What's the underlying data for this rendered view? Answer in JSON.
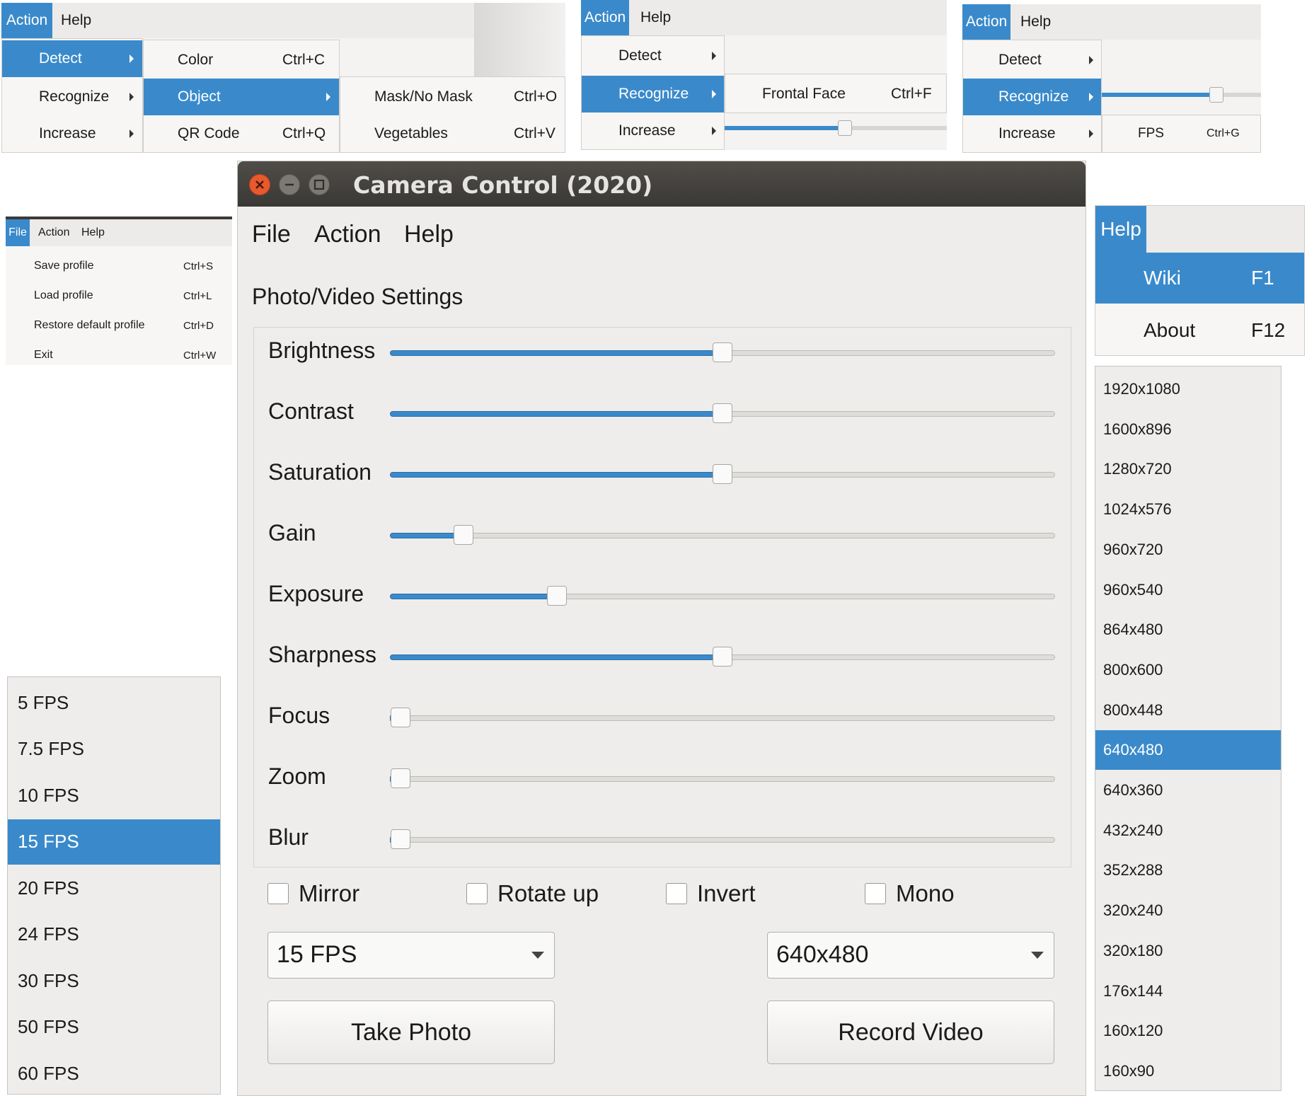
{
  "snippet1": {
    "menubar": [
      "Action",
      "Help"
    ],
    "menu": [
      {
        "label": "Detect"
      },
      {
        "label": "Recognize"
      },
      {
        "label": "Increase"
      }
    ],
    "detect_submenu": [
      {
        "label": "Color",
        "shortcut": "Ctrl+C"
      },
      {
        "label": "Object",
        "shortcut": ""
      },
      {
        "label": "QR Code",
        "shortcut": "Ctrl+Q"
      }
    ],
    "object_submenu": [
      {
        "label": "Mask/No Mask",
        "shortcut": "Ctrl+O"
      },
      {
        "label": "Vegetables",
        "shortcut": "Ctrl+V"
      }
    ]
  },
  "snippet2": {
    "menubar": [
      "Action",
      "Help"
    ],
    "menu": [
      {
        "label": "Detect"
      },
      {
        "label": "Recognize"
      },
      {
        "label": "Increase"
      }
    ],
    "recognize_submenu": [
      {
        "label": "Frontal Face",
        "shortcut": "Ctrl+F"
      }
    ]
  },
  "snippet3": {
    "menubar": [
      "Action",
      "Help"
    ],
    "menu": [
      {
        "label": "Detect"
      },
      {
        "label": "Recognize"
      },
      {
        "label": "Increase"
      }
    ],
    "increase_submenu": [
      {
        "label": "FPS",
        "shortcut": "Ctrl+G"
      }
    ]
  },
  "file_snippet": {
    "menubar": [
      "File",
      "Action",
      "Help"
    ],
    "items": [
      {
        "label": "Save profile",
        "shortcut": "Ctrl+S"
      },
      {
        "label": "Load profile",
        "shortcut": "Ctrl+L"
      },
      {
        "label": "Restore default profile",
        "shortcut": "Ctrl+D"
      },
      {
        "label": "Exit",
        "shortcut": "Ctrl+W"
      }
    ]
  },
  "help_snippet": {
    "menubar": "Help",
    "items": [
      {
        "label": "Wiki",
        "shortcut": "F1"
      },
      {
        "label": "About",
        "shortcut": "F12"
      }
    ]
  },
  "window": {
    "title": "Camera Control (2020)",
    "menubar": [
      "File",
      "Action",
      "Help"
    ],
    "section_title": "Photo/Video Settings",
    "sliders": [
      {
        "label": "Brightness",
        "value": 0.5
      },
      {
        "label": "Contrast",
        "value": 0.5
      },
      {
        "label": "Saturation",
        "value": 0.5
      },
      {
        "label": "Gain",
        "value": 0.11
      },
      {
        "label": "Exposure",
        "value": 0.25
      },
      {
        "label": "Sharpness",
        "value": 0.5
      },
      {
        "label": "Focus",
        "value": 0
      },
      {
        "label": "Zoom",
        "value": 0
      },
      {
        "label": "Blur",
        "value": 0
      }
    ],
    "checkboxes": [
      "Mirror",
      "Rotate up",
      "Invert",
      "Mono"
    ],
    "fps_combo": "15 FPS",
    "resolution_combo": "640x480",
    "take_photo": "Take Photo",
    "record_video": "Record Video"
  },
  "fps_list": {
    "options": [
      "5 FPS",
      "7.5 FPS",
      "10 FPS",
      "15 FPS",
      "20 FPS",
      "24 FPS",
      "30 FPS",
      "50 FPS",
      "60 FPS"
    ],
    "selected": "15 FPS"
  },
  "resolution_list": {
    "options": [
      "1920x1080",
      "1600x896",
      "1280x720",
      "1024x576",
      "960x720",
      "960x540",
      "864x480",
      "800x600",
      "800x448",
      "640x480",
      "640x360",
      "432x240",
      "352x288",
      "320x240",
      "320x180",
      "176x144",
      "160x120",
      "160x90"
    ],
    "selected": "640x480"
  },
  "colors": {
    "accent": "#3a8acb",
    "title_bar": "#3f3c39",
    "window_bg": "#efedeb",
    "close_button": "#e9592e"
  }
}
